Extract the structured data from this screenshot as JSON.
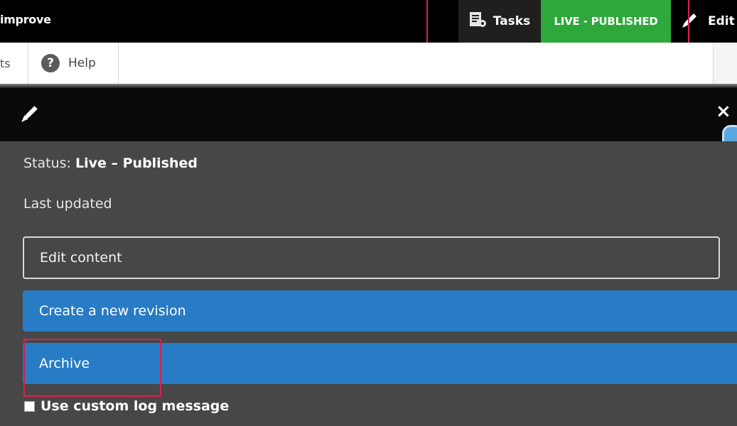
{
  "toolbar": {
    "site_name": "improve",
    "tasks_label": "Tasks",
    "live_badge": "LIVE - PUBLISHED",
    "edit_label": "Edit",
    "live_color": "#2ea73b"
  },
  "tray": {
    "partial_tab": "ts",
    "help_label": "Help",
    "help_icon": "?"
  },
  "dialog": {
    "close": "×",
    "status_prefix": "Status: ",
    "status_value": "Live – Published",
    "last_updated": "Last updated",
    "edit_content": "Edit content",
    "create_revision": "Create a new revision",
    "archive": "Archive",
    "custom_log": "Use custom log message",
    "button_color": "#287bc5"
  },
  "icons": {
    "tasks": "tasks-icon",
    "edit": "pencil-icon",
    "help": "help-icon",
    "close": "close-icon"
  }
}
